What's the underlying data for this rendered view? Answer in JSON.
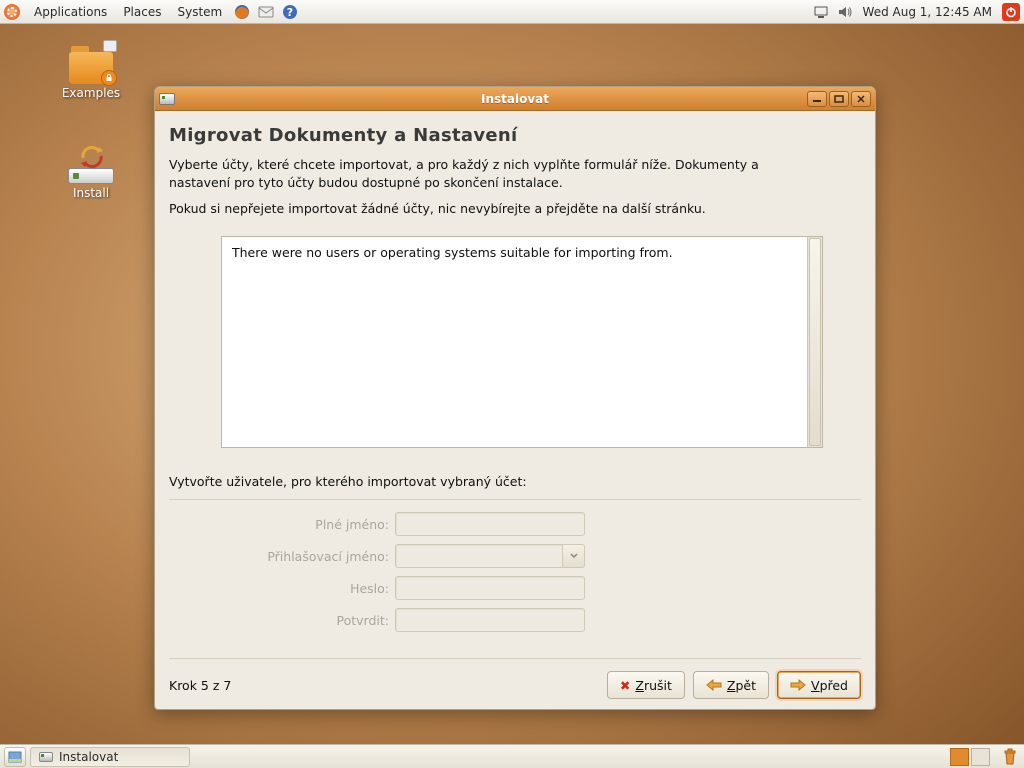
{
  "panel": {
    "menus": [
      "Applications",
      "Places",
      "System"
    ],
    "clock": "Wed Aug  1, 12:45 AM"
  },
  "desktop": {
    "examples_label": "Examples",
    "install_label": "Install"
  },
  "window": {
    "title": "Instalovat",
    "heading": "Migrovat Dokumenty a Nastavení",
    "para1": "Vyberte účty, které chcete importovat, a pro každý z nich vyplňte formulář níže. Dokumenty a nastavení pro tyto účty budou dostupné po skončení instalace.",
    "para2": "Pokud si nepřejete importovat žádné účty, nic nevybírejte a přejděte na další stránku.",
    "list_message": "There were no users or operating systems suitable for importing from.",
    "create_user_label": "Vytvořte uživatele, pro kterého importovat vybraný účet:",
    "fields": {
      "fullname": "Plné jméno:",
      "login": "Přihlašovací jméno:",
      "password": "Heslo:",
      "confirm": "Potvrdit:"
    },
    "step": "Krok 5 z 7",
    "buttons": {
      "cancel_u": "Z",
      "cancel_rest": "rušit",
      "back_u": "Z",
      "back_rest": "pět",
      "next_u": "V",
      "next_rest": "před"
    }
  },
  "taskbar": {
    "task1": "Instalovat"
  }
}
